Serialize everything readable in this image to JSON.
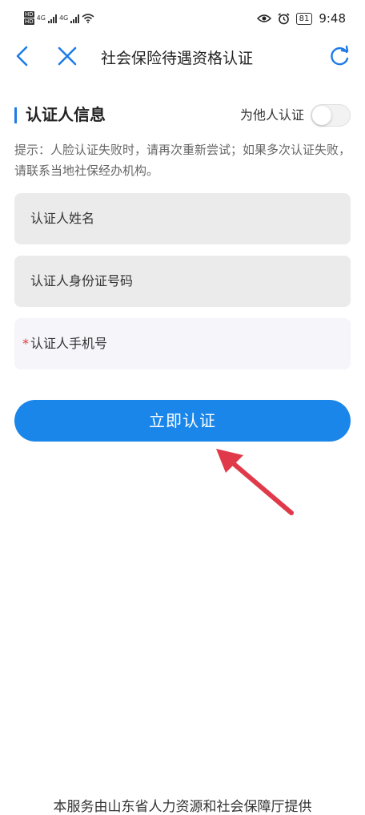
{
  "status_bar": {
    "hd_top": "HD",
    "hd_bottom": "HD",
    "net_1": "4G",
    "net_2": "4G",
    "battery": "81",
    "time": "9:48"
  },
  "nav": {
    "title": "社会保险待遇资格认证"
  },
  "section": {
    "title": "认证人信息",
    "other_label": "为他人认证",
    "other_toggle_on": false
  },
  "tip": "提示：人脸认证失败时，请再次重新尝试；如果多次认证失败，请联系当地社保经办机构。",
  "fields": {
    "name_label": "认证人姓名",
    "id_label": "认证人身份证号码",
    "phone_required_mark": "*",
    "phone_label": "认证人手机号"
  },
  "submit_label": "立即认证",
  "footer": "本服务由山东省人力资源和社会保障厅提供",
  "colors": {
    "accent": "#1a86ea",
    "annotation_arrow": "#e03a4a",
    "required": "#e53935"
  }
}
